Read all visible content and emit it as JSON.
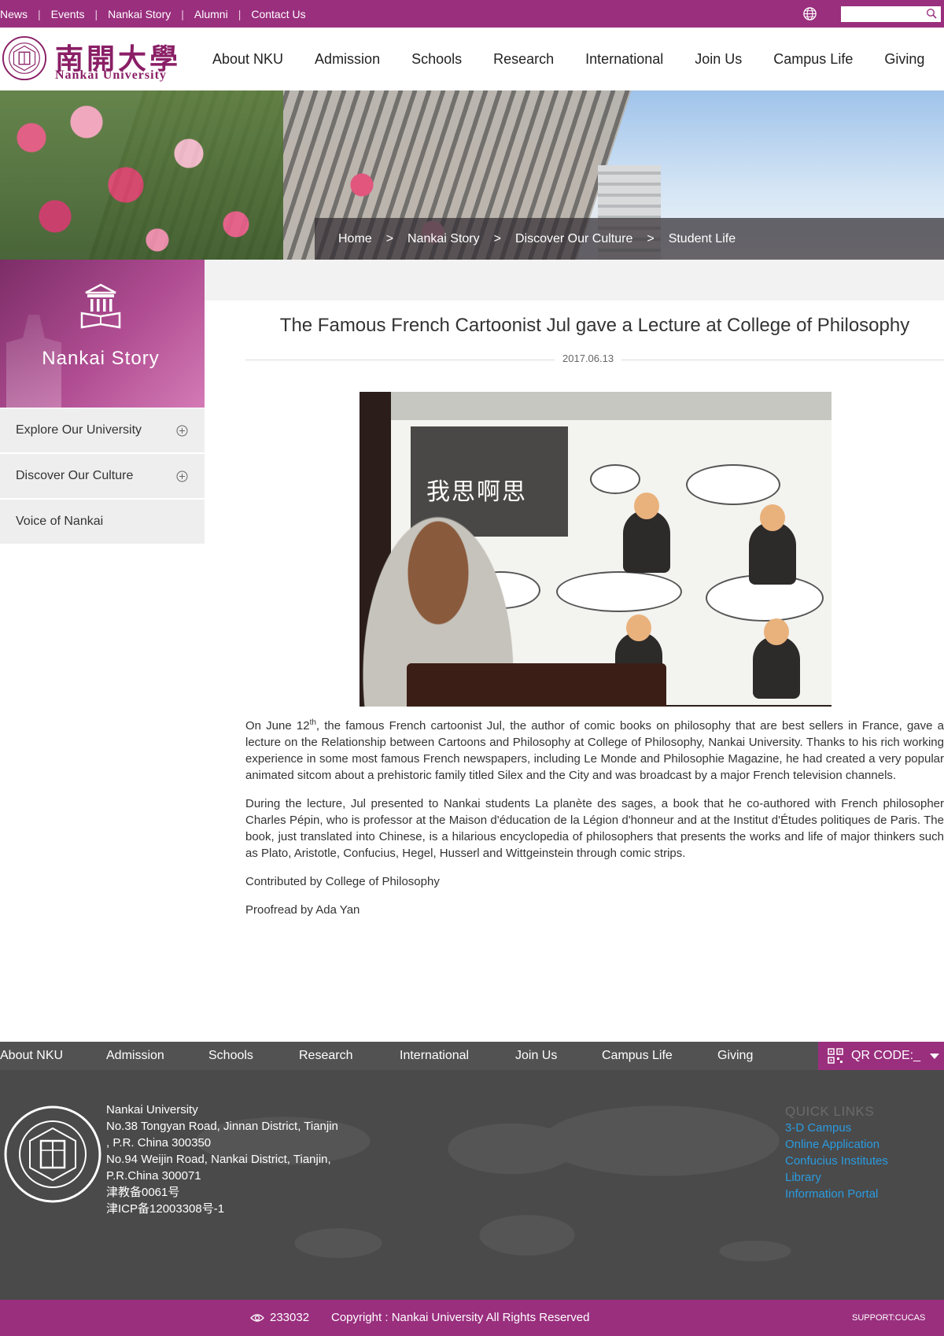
{
  "topbar": {
    "links": [
      "News",
      "Events",
      "Nankai Story",
      "Alumni",
      "Contact Us"
    ],
    "search_placeholder": ""
  },
  "header": {
    "logo_cn": "南開大學",
    "logo_en": "Nankai University",
    "nav": [
      "About NKU",
      "Admission",
      "Schools",
      "Research",
      "International",
      "Join Us",
      "Campus Life",
      "Giving"
    ]
  },
  "breadcrumb": [
    "Home",
    "Nankai Story",
    "Discover Our Culture",
    "Student Life"
  ],
  "breadcrumb_separator": ">",
  "sidebar": {
    "title": "Nankai Story",
    "items": [
      {
        "label": "Explore Our University",
        "expandable": true
      },
      {
        "label": "Discover Our Culture",
        "expandable": true
      },
      {
        "label": "Voice of Nankai",
        "expandable": false
      }
    ]
  },
  "article": {
    "title": "The Famous French Cartoonist Jul gave a Lecture at College of Philosophy",
    "date": "2017.06.13",
    "image_caption_cn": "我思啊思",
    "p1_a": "On June 12",
    "p1_sup": "th",
    "p1_b": ", the famous French cartoonist Jul, the author of comic books on philosophy that are best sellers in France, gave a lecture on the Relationship between Cartoons and Philosophy at College of Philosophy, Nankai University. Thanks to his  rich working experience in some most famous French newspapers, including Le Monde and Philosophie Magazine, he had created a very popular animated sitcom about a prehistoric family titled Silex and the City and was broadcast by a major French television channels.",
    "p2": "During the lecture, Jul presented to Nankai students La planète des sages, a book that he co-authored with French philosopher Charles Pépin, who is professor at the Maison d'éducation de la Légion d'honneur and at the Institut d'Études politiques de Paris. The book, just translated into Chinese, is a hilarious encyclopedia of philosophers that presents the works and life of major thinkers such as Plato, Aristotle, Confucius, Hegel, Husserl and Wittgeinstein through comic strips.",
    "p3": "Contributed by College of Philosophy",
    "p4": "Proofread by Ada Yan"
  },
  "footer_nav": {
    "items": [
      "About NKU",
      "Admission",
      "Schools",
      "Research",
      "International",
      "Join Us",
      "Campus Life",
      "Giving"
    ],
    "qr_label": "QR CODE:_"
  },
  "footer": {
    "address_lines": [
      "Nankai University",
      "No.38 Tongyan Road, Jinnan District, Tianjin",
      ", P.R. China 300350",
      "No.94 Weijin Road,  Nankai District, Tianjin,",
      "P.R.China  300071",
      "津教备0061号",
      "津ICP备12003308号-1"
    ],
    "quick_links_title": "QUICK LINKS",
    "quick_links": [
      "3-D Campus",
      "Online Application",
      "Confucius Institutes",
      "Library",
      "Information Portal"
    ]
  },
  "bottombar": {
    "visit_count": "233032",
    "copyright": "Copyright : Nankai University All Rights Reserved",
    "support": "SUPPORT:CUCAS"
  },
  "colors": {
    "brand": "#9a2f7e",
    "footer_bg": "#4a4a4a",
    "link": "#2b9be0"
  },
  "icons": [
    "globe-icon",
    "search-icon",
    "seal-icon",
    "book-building-icon",
    "plus-circle-icon",
    "qr-code-icon",
    "caret-down-icon",
    "eye-icon"
  ]
}
